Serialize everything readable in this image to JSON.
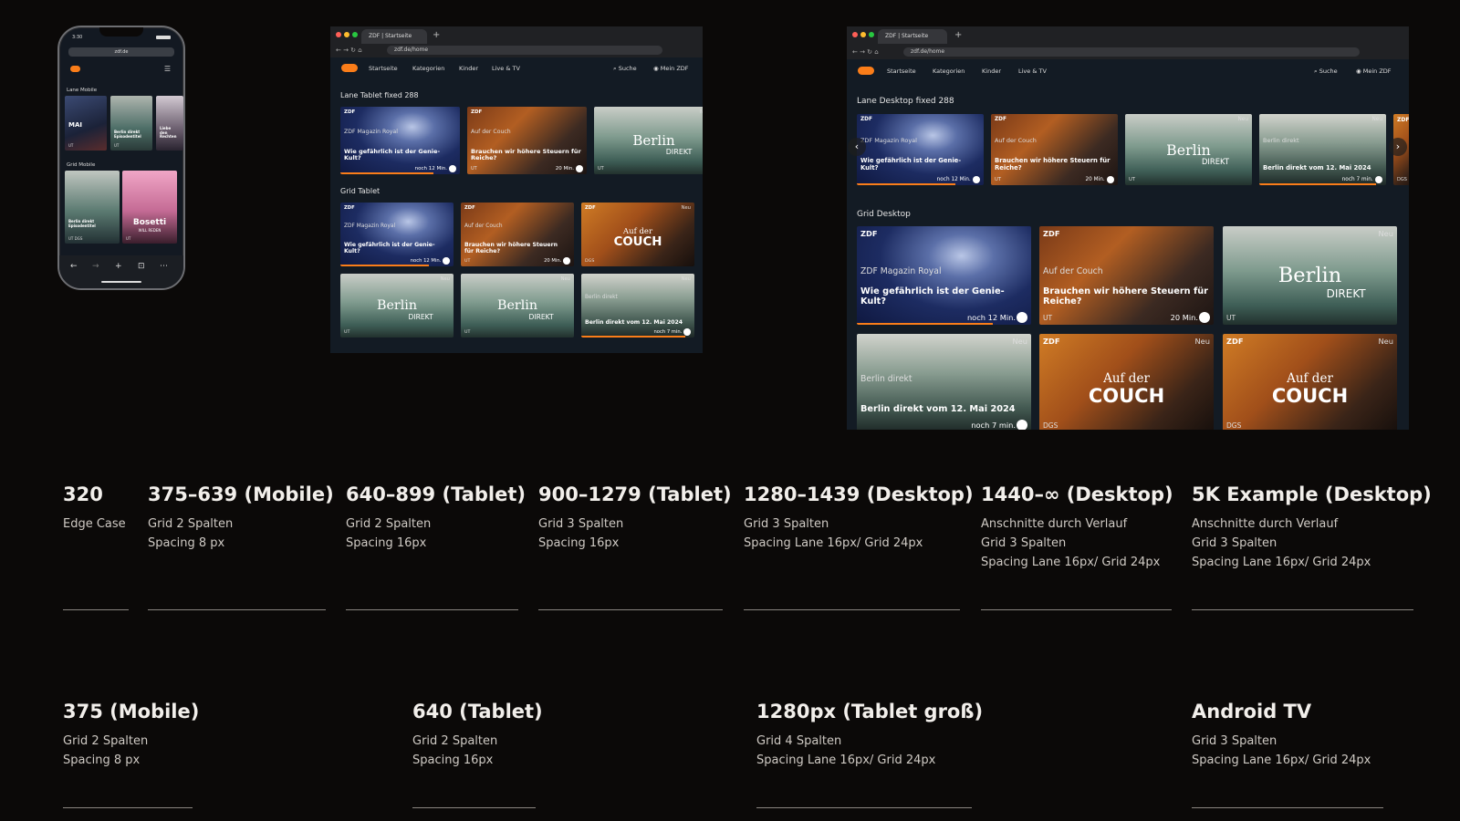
{
  "colors": {
    "background": "#0b0908",
    "accent": "#fa7d19",
    "screen": "#131b24"
  },
  "phone": {
    "time": "3:30",
    "url": "zdf.de",
    "lane_label": "Lane Mobile",
    "grid_label": "Grid Mobile",
    "lane_tiles": [
      {
        "title": "MAI",
        "tag": "UT"
      },
      {
        "title": "Berlin direkt Episodentitel",
        "tag": "UT"
      },
      {
        "title": "Liebe den Rechten",
        "tag": ""
      }
    ],
    "grid_tiles": [
      {
        "title": "Berlin direkt Episodentitel",
        "tag": "UT DGS"
      },
      {
        "title": "Bosetti",
        "subtitle": "WILL REDEN",
        "tag": "UT"
      }
    ]
  },
  "browser": {
    "tab_title": "ZDF | Startseite",
    "url": "zdf.de/home",
    "nav": [
      "Startseite",
      "Kategorien",
      "Kinder",
      "Live & TV"
    ],
    "search": "Suche",
    "account": "Mein ZDF"
  },
  "tablet": {
    "lane_label": "Lane Tablet fixed 288",
    "grid_label": "Grid Tablet"
  },
  "desktop": {
    "lane_label": "Lane Desktop fixed 288",
    "grid_label": "Grid Desktop"
  },
  "tiles": {
    "royal": {
      "badge": "ZDF",
      "subtitle": "ZDF Magazin Royal",
      "title": "Wie gefährlich ist der Genie-Kult?",
      "duration": "noch 12 Min.",
      "tag": ""
    },
    "couch_ep": {
      "badge": "ZDF",
      "subtitle": "Auf der Couch",
      "title": "Brauchen wir höhere Steuern für Reiche?",
      "duration": "20 Min.",
      "tag": "UT"
    },
    "berlin_show": {
      "badge": "",
      "neu": "Neu",
      "logo": "Berlin",
      "logo_sub": "DIREKT",
      "tag": "UT"
    },
    "berlin_ep": {
      "badge": "",
      "neu": "Neu",
      "subtitle": "Berlin direkt",
      "title": "Berlin direkt vom 12. Mai 2024",
      "duration": "noch 7 min.",
      "tag": ""
    },
    "couch_show": {
      "badge": "ZDF",
      "neu": "Neu",
      "logo": "Auf der",
      "logo_sub": "COUCH",
      "tag": "DGS"
    },
    "lane_edge_tag": "DGS"
  },
  "breakpoints_row1": [
    {
      "heading": "320",
      "lines": [
        "Edge Case"
      ]
    },
    {
      "heading": "375–639 (Mobile)",
      "lines": [
        "Grid 2 Spalten",
        "Spacing 8 px"
      ]
    },
    {
      "heading": "640–899 (Tablet)",
      "lines": [
        "Grid 2 Spalten",
        "Spacing 16px"
      ]
    },
    {
      "heading": "900–1279 (Tablet)",
      "lines": [
        "Grid 3 Spalten",
        "Spacing 16px"
      ]
    },
    {
      "heading": "1280–1439 (Desktop)",
      "lines": [
        "Grid 3 Spalten",
        "Spacing Lane 16px/ Grid 24px"
      ]
    },
    {
      "heading": "1440–∞ (Desktop)",
      "lines": [
        "Anschnitte durch Verlauf",
        "Grid 3 Spalten",
        "Spacing Lane 16px/ Grid 24px"
      ]
    },
    {
      "heading": "5K Example (Desktop)",
      "lines": [
        "Anschnitte durch Verlauf",
        "Grid 3 Spalten",
        "Spacing Lane 16px/ Grid 24px"
      ]
    }
  ],
  "breakpoints_row2": [
    {
      "heading": "375 (Mobile)",
      "lines": [
        "Grid 2 Spalten",
        "Spacing 8 px"
      ]
    },
    {
      "heading": "640 (Tablet)",
      "lines": [
        "Grid 2 Spalten",
        "Spacing 16px"
      ]
    },
    {
      "heading": "1280px (Tablet groß)",
      "lines": [
        "Grid 4 Spalten",
        "Spacing Lane 16px/ Grid 24px"
      ]
    },
    {
      "heading": "Android TV",
      "lines": [
        "Grid 3 Spalten",
        "Spacing Lane 16px/ Grid 24px"
      ]
    }
  ]
}
